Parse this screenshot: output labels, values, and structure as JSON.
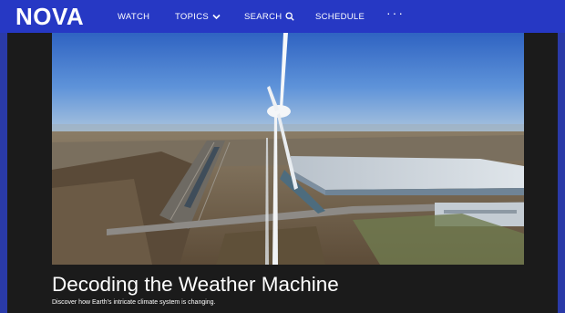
{
  "header": {
    "logo": "NOVA",
    "nav": {
      "watch": "WATCH",
      "topics": "TOPICS",
      "search": "SEARCH",
      "schedule": "SCHEDULE",
      "more": "···"
    }
  },
  "hero": {
    "image_alt": "Aerial view of a wind turbine beside a large warehouse and rail yard"
  },
  "episode": {
    "title": "Decoding the Weather Machine",
    "description": "Discover how Earth's intricate climate system is changing."
  },
  "colors": {
    "nav_bg": "#2638c4",
    "page_bg": "#1b1b1b",
    "text": "#ffffff"
  }
}
